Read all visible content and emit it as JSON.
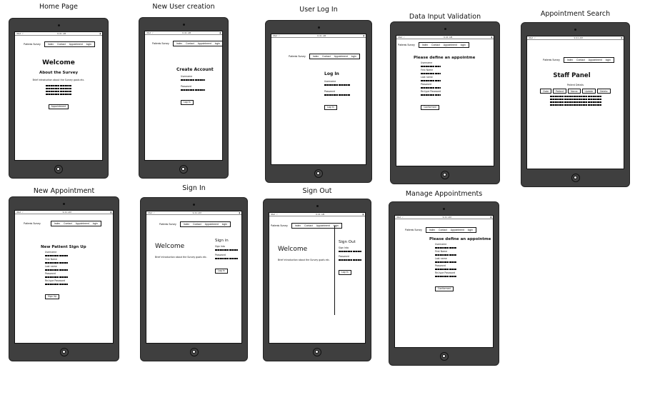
{
  "nav": {
    "brand": "Patients Survey",
    "items": [
      "Index",
      "Contact",
      "Appointment",
      "login"
    ]
  },
  "status_bar": {
    "carrier": "iPad ⌔",
    "time": "9:41 AM",
    "battery": "▮"
  },
  "screens": {
    "home": {
      "caption": "Home Page",
      "welcome": "Welcome",
      "about": "About the Survey",
      "intro": "Brief introduction about the Survey goals etc.",
      "button": "Appointment"
    },
    "new_user": {
      "caption": "New User creation",
      "title": "Create Account",
      "username_label": "Username",
      "password_label": "Password",
      "button": "Log In"
    },
    "user_login": {
      "caption": "User Log In",
      "title": "Log In",
      "username_label": "Username",
      "password_label": "Password",
      "button": "Log In"
    },
    "validation": {
      "caption": "Data Input Validation",
      "title": "Please define an appointme",
      "labels": [
        "Username",
        "First Name",
        "Last name",
        "Password",
        "Re-type Password"
      ],
      "button": "Conformed"
    },
    "search": {
      "caption": "Appointment Search",
      "title": "Staff Panel",
      "subtitle": "Patient Details",
      "buttons": [
        "Date",
        "Patient",
        "Name",
        "Update",
        "Delete"
      ]
    },
    "new_appt": {
      "caption": "New Appointment",
      "title": "New Patient Sign Up",
      "labels": [
        "Username",
        "First Name",
        "Last name",
        "Password",
        "Re-type Password"
      ],
      "button": "Sign Up"
    },
    "sign_in": {
      "caption": "Sign In",
      "welcome": "Welcome",
      "intro": "Brief introduction about the Survey goals etc.",
      "panel_title": "Sign in",
      "username_label": "Sign Into",
      "password_label": "Password",
      "button": "Log In"
    },
    "sign_out": {
      "caption": "Sign Out",
      "welcome": "Welcome",
      "intro": "Brief introduction about the Survey goals etc.",
      "panel_title": "Sign Out",
      "username_label": "Sign Into",
      "password_label": "Password",
      "button": "Log In"
    },
    "manage": {
      "caption": "Manage Appointments",
      "title": "Please define an appointme",
      "labels": [
        "Username",
        "First Name",
        "Last name",
        "Password",
        "Re-type Password"
      ],
      "button": "Conformed"
    }
  }
}
